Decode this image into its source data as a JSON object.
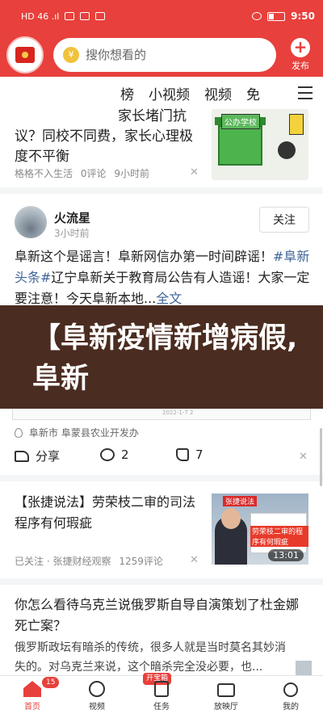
{
  "status_bar": {
    "left_text": "HD 46 .ıl",
    "time": "9:50"
  },
  "header": {
    "search_placeholder": "搜你想看的",
    "publish_label": "发布"
  },
  "tabs": [
    "榜",
    "小视频",
    "视频",
    "免"
  ],
  "article1": {
    "title_line1": "家长堵门抗",
    "title_rest": "议？同校不同费，家长心理极度不平衡",
    "source": "格格不入生活",
    "comments": "0评论",
    "time": "9小时前",
    "thumb_label": "公办学校"
  },
  "post2": {
    "author": "火流星",
    "time": "3小时前",
    "follow_label": "关注",
    "text_before": "阜新这个是谣言！阜新网信办第一时间辟谣！",
    "hashtag": "#阜新头条#",
    "text_after": "辽宁阜新关于教育局公告有人造谣！大家一定要注意！今天阜新本地...",
    "more": "全文",
    "banner_text": "【阜新疫情新增病假,阜新",
    "banner_footer": "2022-1-7 2",
    "location": "阜新市 阜蒙县农业开发办",
    "share_label": "分享",
    "comment_count": "2",
    "like_count": "7"
  },
  "article3": {
    "title": "【张捷说法】劳荣枝二审的司法程序有何瑕疵",
    "followed": "已关注",
    "source": "张捷财经观察",
    "comments": "1259评论",
    "duration": "13:01",
    "thumb_banner": "张捷说法",
    "thumb_caption": "劳荣枝二审的程序有何瑕疵"
  },
  "article4": {
    "title": "你怎么看待乌克兰说俄罗斯自导自演策划了杜金娜死亡案？",
    "snippet": "俄罗斯政坛有暗杀的传统，很多人就是当时莫名其妙消失的。对乌克兰来说，这个暗杀完全没必要，也..."
  },
  "bottom_nav": {
    "home": "首页",
    "home_badge": "15",
    "video": "视频",
    "tasks": "任务",
    "tasks_badge": "开宝箱",
    "cinema": "放映厅",
    "me": "我的"
  },
  "colors": {
    "brand_red": "#e8403c",
    "link_blue": "#406599"
  }
}
